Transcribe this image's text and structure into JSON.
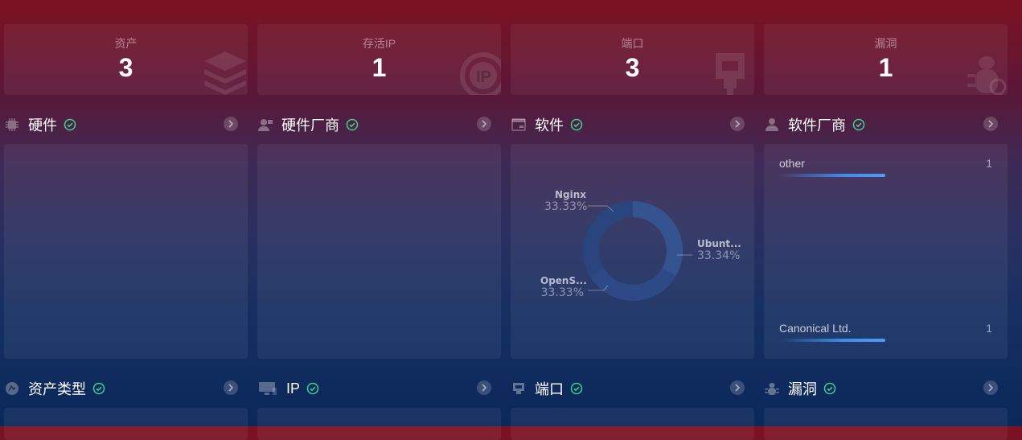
{
  "stats": [
    {
      "label": "资产",
      "value": "3",
      "icon": "layers-icon"
    },
    {
      "label": "存活IP",
      "value": "1",
      "icon": "ip-badge-icon"
    },
    {
      "label": "端口",
      "value": "3",
      "icon": "ethernet-port-icon"
    },
    {
      "label": "漏洞",
      "value": "1",
      "icon": "bug-icon"
    }
  ],
  "panels_row1": [
    {
      "title": "硬件",
      "icon": "chip-icon"
    },
    {
      "title": "硬件厂商",
      "icon": "vendor-user-icon"
    },
    {
      "title": "软件",
      "icon": "software-window-icon"
    },
    {
      "title": "软件厂商",
      "icon": "person-icon"
    }
  ],
  "panels_row2": [
    {
      "title": "资产类型",
      "icon": "asset-type-icon"
    },
    {
      "title": "IP",
      "icon": "monitor-icon"
    },
    {
      "title": "端口",
      "icon": "port-icon"
    },
    {
      "title": "漏洞",
      "icon": "bug-icon"
    }
  ],
  "software_chart": {
    "type": "pie",
    "slices": [
      {
        "name": "Nginx",
        "percent_label": "33.33%",
        "value": 33.33
      },
      {
        "name": "Ubunt...",
        "percent_label": "33.34%",
        "value": 33.34
      },
      {
        "name": "OpenS...",
        "percent_label": "33.33%",
        "value": 33.33
      }
    ]
  },
  "software_vendors": [
    {
      "name": "other",
      "count": "1",
      "share": 1.0
    },
    {
      "name": "Canonical Ltd.",
      "count": "1",
      "share": 1.0
    }
  ],
  "colors": {
    "accent": "#4f9bf5",
    "ok": "#3fd08a",
    "donut": "#2d4a86"
  }
}
